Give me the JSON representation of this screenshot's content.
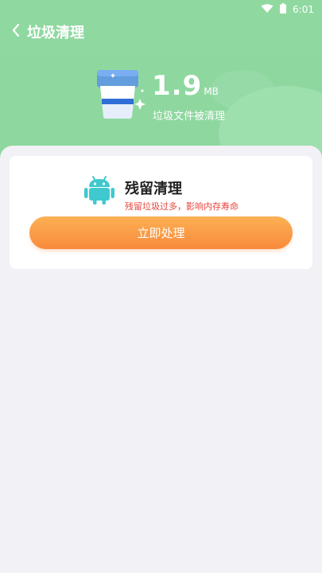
{
  "status_bar": {
    "time": "6:01",
    "icons": [
      "wifi-icon",
      "battery-icon"
    ]
  },
  "nav": {
    "title": "垃圾清理",
    "back_icon": "chevron-left-icon"
  },
  "summary": {
    "size_value": "1.9",
    "size_unit": "MB",
    "description": "垃圾文件被清理",
    "icon": "trash-bin-icon"
  },
  "card": {
    "icon": "android-icon",
    "title": "残留清理",
    "warning": "残留垃圾过多，影响内存寿命",
    "button_label": "立即处理"
  },
  "colors": {
    "header_green": "#8fd9a0",
    "page_background": "#f2f1f6",
    "warning_red": "#e8443b",
    "button_orange": "#f98a3c",
    "android_teal": "#3fc9cf"
  }
}
